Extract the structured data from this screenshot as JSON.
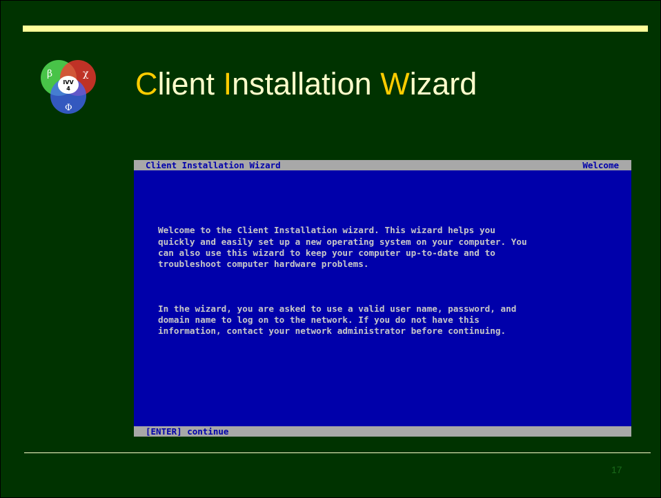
{
  "slide": {
    "title_parts": [
      {
        "text": "C",
        "accent": true
      },
      {
        "text": "lient ",
        "accent": false
      },
      {
        "text": "I",
        "accent": true
      },
      {
        "text": "nstallation ",
        "accent": false
      },
      {
        "text": "W",
        "accent": true
      },
      {
        "text": "izard",
        "accent": false
      }
    ],
    "page_number": "17",
    "logo": {
      "center_text": "IVV",
      "center_number": "4",
      "symbols": [
        "β",
        "χ",
        "Φ"
      ]
    }
  },
  "console": {
    "header_title": "Client Installation Wizard",
    "header_right": "Welcome",
    "paragraphs": [
      "Welcome to the Client Installation wizard. This wizard helps you\nquickly and easily set up a new operating system on your computer. You\ncan also use this wizard to keep your computer up-to-date and to\ntroubleshoot computer hardware problems.",
      "In the wizard, you are asked to use a valid user name, password, and\ndomain name to log on to the network. If you do not have this\ninformation, contact your network administrator before continuing."
    ],
    "footer_hint": "[ENTER] continue"
  },
  "colors": {
    "slide_background": "#003300",
    "title_text": "#ffffcc",
    "title_accent": "#ffcc00",
    "console_background": "#0000aa",
    "console_bar": "#a8a8a8",
    "console_text": "#c8c8c8"
  }
}
